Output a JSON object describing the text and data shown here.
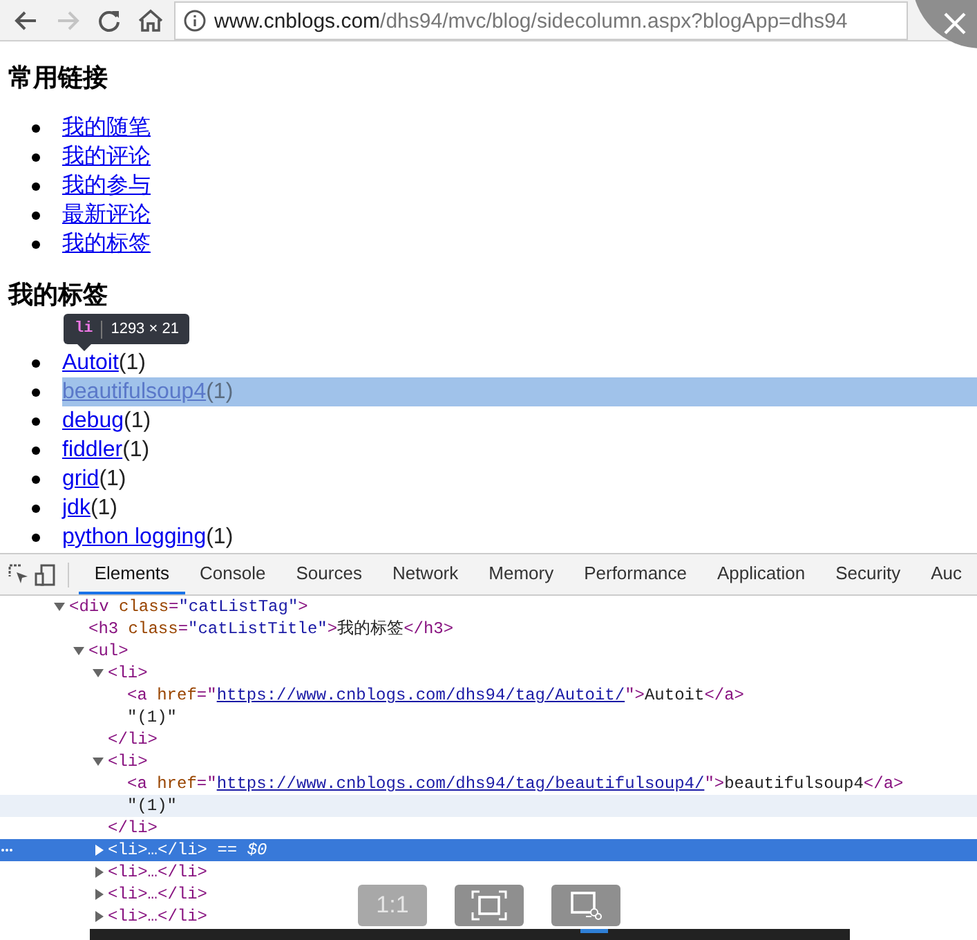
{
  "browser": {
    "back_disabled": false,
    "forward_disabled": true,
    "url_host": "www.cnblogs.com",
    "url_path": "/dhs94/mvc/blog/sidecolumn.aspx?blogApp=dhs94"
  },
  "page": {
    "sections": [
      {
        "heading": "常用链接",
        "items": [
          {
            "link": "我的随笔",
            "highlighted": false
          },
          {
            "link": "我的评论",
            "highlighted": false
          },
          {
            "link": "我的参与",
            "highlighted": false
          },
          {
            "link": "最新评论",
            "highlighted": false
          },
          {
            "link": "我的标签",
            "highlighted": false
          }
        ]
      },
      {
        "heading": "我的标签",
        "items": [
          {
            "link": "Autoit",
            "count": "(1)",
            "highlighted": false
          },
          {
            "link": "beautifulsoup4",
            "count": "(1)",
            "highlighted": true
          },
          {
            "link": "debug",
            "count": "(1)",
            "highlighted": false
          },
          {
            "link": "fiddler",
            "count": "(1)",
            "highlighted": false
          },
          {
            "link": "grid",
            "count": "(1)",
            "highlighted": false
          },
          {
            "link": "jdk",
            "count": "(1)",
            "highlighted": false
          },
          {
            "link": "python logging",
            "count": "(1)",
            "highlighted": false
          }
        ]
      }
    ]
  },
  "inspect_tooltip": {
    "tag": "li",
    "size": "1293 × 21"
  },
  "devtools": {
    "tabs": [
      {
        "label": "Elements",
        "selected": true
      },
      {
        "label": "Console",
        "selected": false
      },
      {
        "label": "Sources",
        "selected": false
      },
      {
        "label": "Network",
        "selected": false
      },
      {
        "label": "Memory",
        "selected": false
      },
      {
        "label": "Performance",
        "selected": false
      },
      {
        "label": "Application",
        "selected": false
      },
      {
        "label": "Security",
        "selected": false
      },
      {
        "label": "Auc",
        "selected": false
      }
    ],
    "tree": [
      {
        "expanded": true,
        "tokens": [
          {
            "kind": "tag",
            "t": "<div"
          },
          {
            "kind": "attr",
            "t": " class"
          },
          {
            "kind": "tag",
            "t": "="
          },
          {
            "kind": "val",
            "t": "\"catListTag\""
          },
          {
            "kind": "tag",
            "t": ">"
          }
        ],
        "children": [
          {
            "tokens": [
              {
                "kind": "tag",
                "t": "<h3"
              },
              {
                "kind": "attr",
                "t": " class"
              },
              {
                "kind": "tag",
                "t": "="
              },
              {
                "kind": "val",
                "t": "\"catListTitle\""
              },
              {
                "kind": "tag",
                "t": ">"
              },
              {
                "kind": "text",
                "t": "我的标签"
              },
              {
                "kind": "tag",
                "t": "</h3>"
              }
            ]
          },
          {
            "expanded": true,
            "tokens": [
              {
                "kind": "tag",
                "t": "<ul>"
              }
            ],
            "children": [
              {
                "expanded": true,
                "tokens": [
                  {
                    "kind": "tag",
                    "t": "<li>"
                  }
                ],
                "children": [
                  {
                    "tokens": [
                      {
                        "kind": "tag",
                        "t": "<a"
                      },
                      {
                        "kind": "attr",
                        "t": " href"
                      },
                      {
                        "kind": "tag",
                        "t": "=\""
                      },
                      {
                        "kind": "link",
                        "t": "https://www.cnblogs.com/dhs94/tag/Autoit/"
                      },
                      {
                        "kind": "tag",
                        "t": "\">"
                      },
                      {
                        "kind": "text",
                        "t": "Autoit"
                      },
                      {
                        "kind": "tag",
                        "t": "</a>"
                      }
                    ]
                  },
                  {
                    "tokens": [
                      {
                        "kind": "text",
                        "t": "\"(1)\""
                      }
                    ]
                  }
                ],
                "closing": [
                  {
                    "kind": "tag",
                    "t": "</li>"
                  }
                ]
              },
              {
                "expanded": true,
                "tokens": [
                  {
                    "kind": "tag",
                    "t": "<li>"
                  }
                ],
                "children": [
                  {
                    "tokens": [
                      {
                        "kind": "tag",
                        "t": "<a"
                      },
                      {
                        "kind": "attr",
                        "t": " href"
                      },
                      {
                        "kind": "tag",
                        "t": "=\""
                      },
                      {
                        "kind": "link",
                        "t": "https://www.cnblogs.com/dhs94/tag/beautifulsoup4/"
                      },
                      {
                        "kind": "tag",
                        "t": "\">"
                      },
                      {
                        "kind": "text",
                        "t": "beautifulsoup4"
                      },
                      {
                        "kind": "tag",
                        "t": "</a>"
                      }
                    ]
                  },
                  {
                    "hovered": true,
                    "tokens": [
                      {
                        "kind": "text",
                        "t": "\"(1)\""
                      }
                    ]
                  }
                ],
                "closing": [
                  {
                    "kind": "tag",
                    "t": "</li>"
                  }
                ]
              },
              {
                "expanded": false,
                "selected": true,
                "tokens": [
                  {
                    "kind": "tag",
                    "t": "<li>…</li>"
                  },
                  {
                    "kind": "marker",
                    "t": " == $0"
                  }
                ]
              },
              {
                "expanded": false,
                "tokens": [
                  {
                    "kind": "tag",
                    "t": "<li>…</li>"
                  }
                ]
              },
              {
                "expanded": false,
                "tokens": [
                  {
                    "kind": "tag",
                    "t": "<li>…</li>"
                  }
                ]
              },
              {
                "expanded": false,
                "tokens": [
                  {
                    "kind": "tag",
                    "t": "<li>…</li>"
                  }
                ]
              }
            ]
          }
        ]
      }
    ]
  },
  "capture_toolbar": {
    "buttons": [
      {
        "kind": "text",
        "label": "1:1",
        "disabled": true
      },
      {
        "kind": "fit",
        "disabled": false
      },
      {
        "kind": "crop",
        "disabled": false
      }
    ]
  }
}
